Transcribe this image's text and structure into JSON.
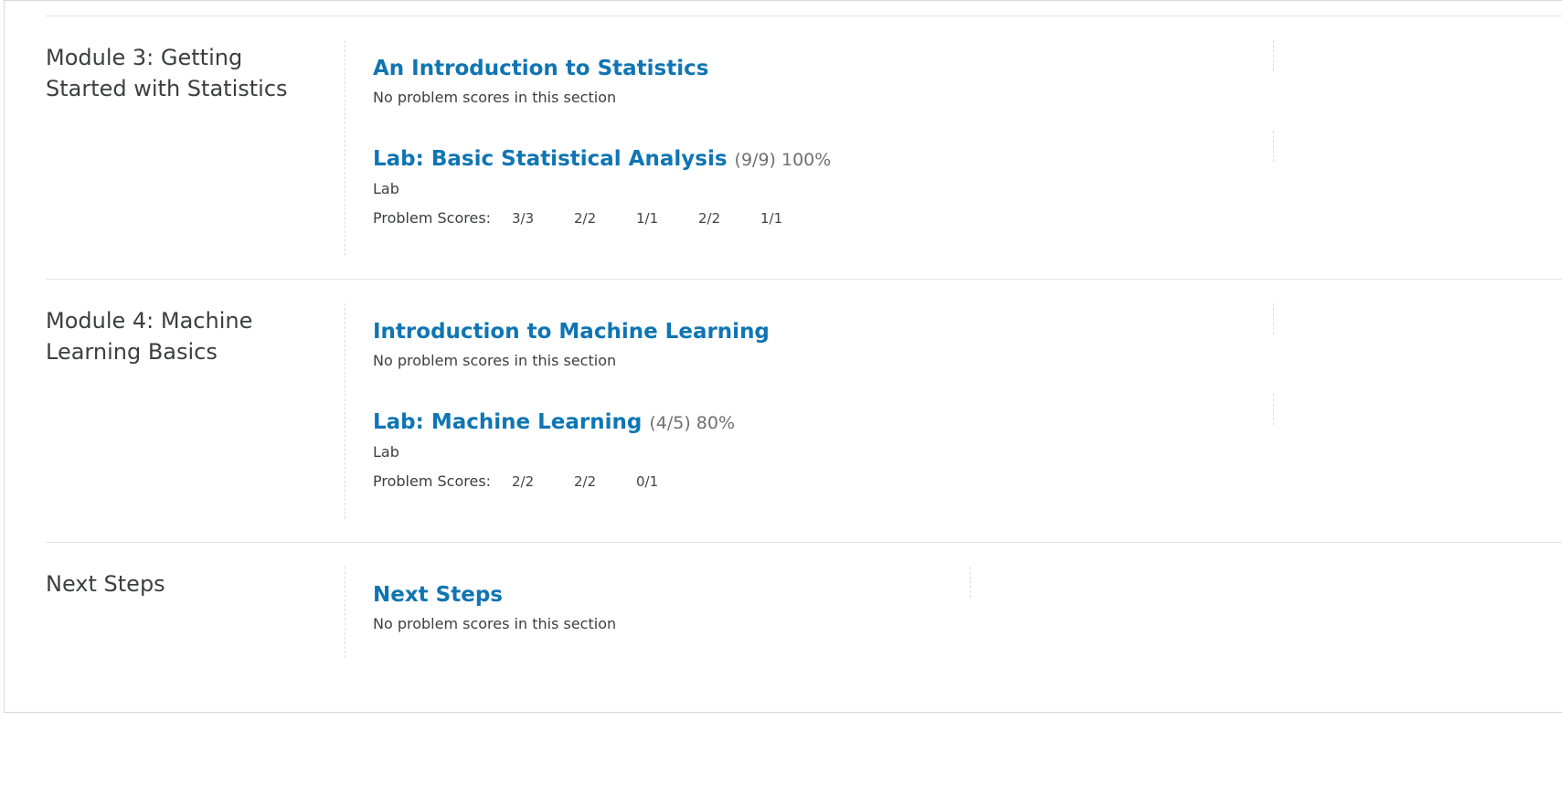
{
  "chapters": [
    {
      "title": "Module 3: Getting Started with Statistics",
      "sections": [
        {
          "title": "An Introduction to Statistics",
          "score": "",
          "note": "No problem scores in this section"
        },
        {
          "title": "Lab: Basic Statistical Analysis",
          "score": "(9/9) 100%",
          "type": "Lab",
          "scores_label": "Problem Scores:",
          "scores": [
            "3/3",
            "2/2",
            "1/1",
            "2/2",
            "1/1"
          ]
        }
      ]
    },
    {
      "title": "Module 4: Machine Learning Basics",
      "sections": [
        {
          "title": "Introduction to Machine Learning",
          "score": "",
          "note": "No problem scores in this section"
        },
        {
          "title": "Lab: Machine Learning",
          "score": "(4/5) 80%",
          "type": "Lab",
          "scores_label": "Problem Scores:",
          "scores": [
            "2/2",
            "2/2",
            "0/1"
          ]
        }
      ]
    },
    {
      "title": "Next Steps",
      "sections": [
        {
          "title": "Next Steps",
          "score": "",
          "note": "No problem scores in this section"
        }
      ]
    }
  ],
  "colors": {
    "link": "#0f75b4",
    "text": "#3d3e3f",
    "muted": "#707070"
  }
}
